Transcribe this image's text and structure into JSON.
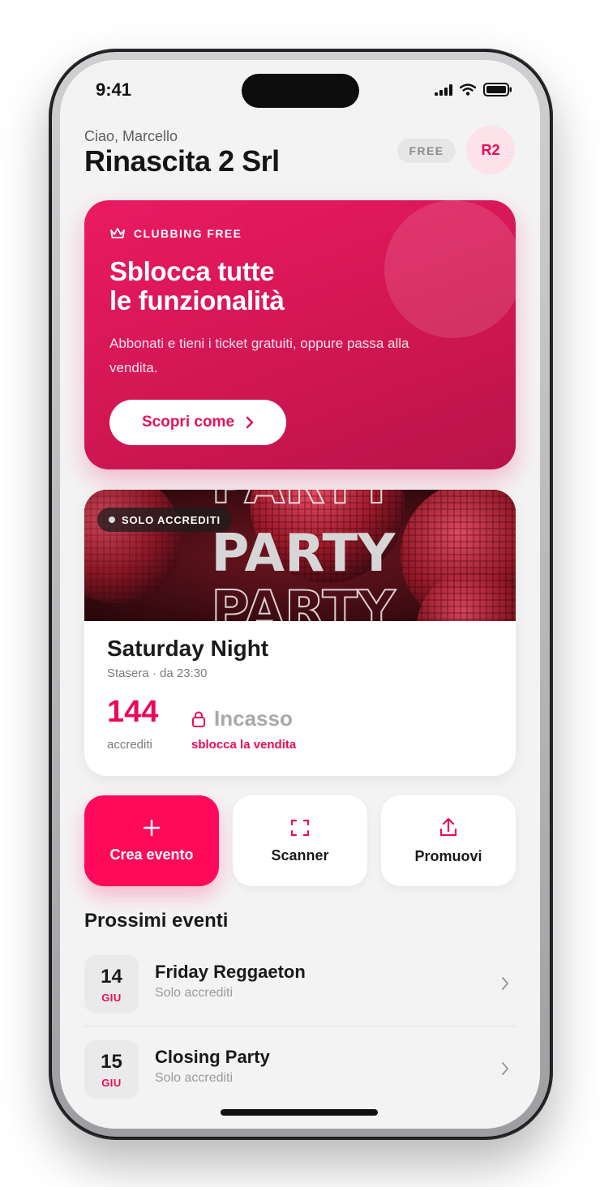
{
  "status_bar": {
    "time": "9:41"
  },
  "header": {
    "greeting": "Ciao, Marcello",
    "company": "Rinascita 2 Srl",
    "plan_badge": "FREE",
    "avatar_initials": "R2"
  },
  "promo": {
    "eyebrow": "CLUBBING FREE",
    "eyebrow_icon": "crown-icon",
    "title_line1": "Sblocca tutte",
    "title_line2": "le funzionalità",
    "description": "Abbonati e tieni i ticket gratuiti, oppure passa alla vendita.",
    "cta_label": "Scopri come"
  },
  "event": {
    "cover_tag": "SOLO ACCREDITI",
    "cover_word": "PARTY",
    "title": "Saturday Night",
    "subtitle": "Stasera · da 23:30",
    "count": "144",
    "count_label": "accrediti",
    "revenue_label": "Incasso",
    "revenue_link": "sblocca la vendita"
  },
  "actions": [
    {
      "label": "Crea evento",
      "icon": "plus-icon"
    },
    {
      "label": "Scanner",
      "icon": "scan-icon"
    },
    {
      "label": "Promuovi",
      "icon": "share-icon"
    }
  ],
  "upcoming": {
    "title": "Prossimi eventi",
    "items": [
      {
        "day": "14",
        "month": "GIU",
        "name": "Friday Reggaeton",
        "type": "Solo accrediti"
      },
      {
        "day": "15",
        "month": "GIU",
        "name": "Closing Party",
        "type": "Solo accrediti"
      }
    ]
  },
  "colors": {
    "accent": "#ff0a5a",
    "accent_text": "#ea0a5b",
    "background": "#f4f3f3"
  }
}
